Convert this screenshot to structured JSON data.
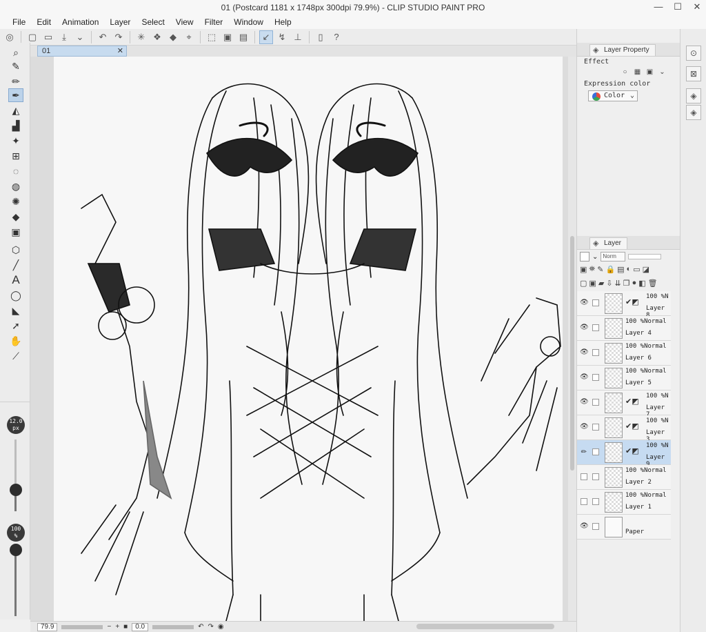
{
  "window": {
    "title": "01 (Postcard 1181 x 1748px 300dpi 79.9%) - CLIP STUDIO PAINT PRO",
    "minimize": "—",
    "maximize": "☐",
    "close": "✕"
  },
  "menu": [
    "File",
    "Edit",
    "Animation",
    "Layer",
    "Select",
    "View",
    "Filter",
    "Window",
    "Help"
  ],
  "document": {
    "tab_label": "01",
    "tab_close": "✕"
  },
  "brush": {
    "size_value": "12.0",
    "size_unit": "px",
    "size_level": 0.3,
    "opacity_value": "100",
    "opacity_unit": "%",
    "opacity_level": 1.0
  },
  "status": {
    "zoom": "79.9",
    "minus": "−",
    "plus": "+",
    "rotation": "0.0"
  },
  "layer_property": {
    "tab_label": "Layer Property",
    "effect_label": "Effect",
    "expression_color_label": "Expression color",
    "expression_color_value": "Color"
  },
  "layer_panel": {
    "tab_label": "Layer",
    "blend_mode_short": "Norm"
  },
  "layers": [
    {
      "name": "Layer 8",
      "blend": "100 %N",
      "visible": true,
      "clip": true,
      "selected": false
    },
    {
      "name": "Layer 4",
      "blend": "100 %Normal",
      "visible": true,
      "clip": false,
      "selected": false
    },
    {
      "name": "Layer 6",
      "blend": "100 %Normal",
      "visible": true,
      "clip": false,
      "selected": false
    },
    {
      "name": "Layer 5",
      "blend": "100 %Normal",
      "visible": true,
      "clip": false,
      "selected": false
    },
    {
      "name": "Layer 7",
      "blend": "100 %N",
      "visible": true,
      "clip": true,
      "selected": false
    },
    {
      "name": "Layer 3",
      "blend": "100 %N",
      "visible": true,
      "clip": true,
      "selected": false
    },
    {
      "name": "Layer 9",
      "blend": "100 %N",
      "visible": false,
      "clip": true,
      "selected": true
    },
    {
      "name": "Layer 2",
      "blend": "100 %Normal",
      "visible": false,
      "clip": false,
      "selected": false
    },
    {
      "name": "Layer 1",
      "blend": "100 %Normal",
      "visible": false,
      "clip": false,
      "selected": false
    },
    {
      "name": "Paper",
      "blend": "",
      "visible": true,
      "clip": false,
      "selected": false,
      "paper": true
    }
  ],
  "colors": {
    "main_color": "#b0b0b0",
    "sub_color": "#444444",
    "selection": "#c6dbf1"
  }
}
